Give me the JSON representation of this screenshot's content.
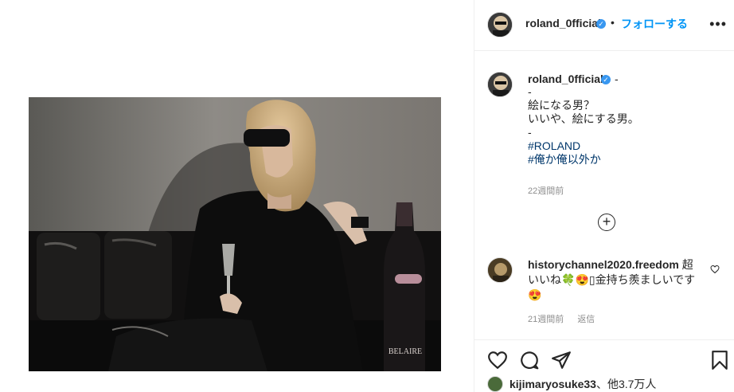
{
  "post": {
    "username": "roland_0fficial",
    "verified_badge": "✓",
    "separator": "•",
    "follow_label": "フォローする",
    "more_label": "•••"
  },
  "caption": {
    "username": "roland_0fficial",
    "verified_badge": "✓",
    "trailing": "-",
    "lines": [
      "-",
      "絵になる男？",
      "いいや、絵にする男。",
      "-"
    ],
    "hashtags": [
      "#ROLAND",
      "#俺か俺以外か"
    ],
    "time": "22週間前"
  },
  "load_more": {
    "label": "+"
  },
  "comment": {
    "username": "historychannel2020.freedom",
    "text_part1": "超いいね",
    "emoji_1": "🍀",
    "emoji_2": "😍",
    "missing_glyph": "▯",
    "text_part2": "金持ち羨ましいです",
    "emoji_3": "😍",
    "time": "21週間前",
    "reply_label": "返信"
  },
  "likes": {
    "user": "kijimaryosuke33",
    "suffix": "、他3.7万人"
  },
  "icons": {
    "header_more": "more-options-icon",
    "comment_like": "heart-outline-icon",
    "like": "heart-icon",
    "comment": "comment-bubble-icon",
    "share": "paper-plane-icon",
    "save": "bookmark-icon",
    "verified": "verified-badge-icon"
  },
  "colors": {
    "link_blue": "#0095f6",
    "hashtag": "#00376b",
    "muted": "#8e8e8e",
    "text": "#262626",
    "verified": "#3897f0"
  }
}
